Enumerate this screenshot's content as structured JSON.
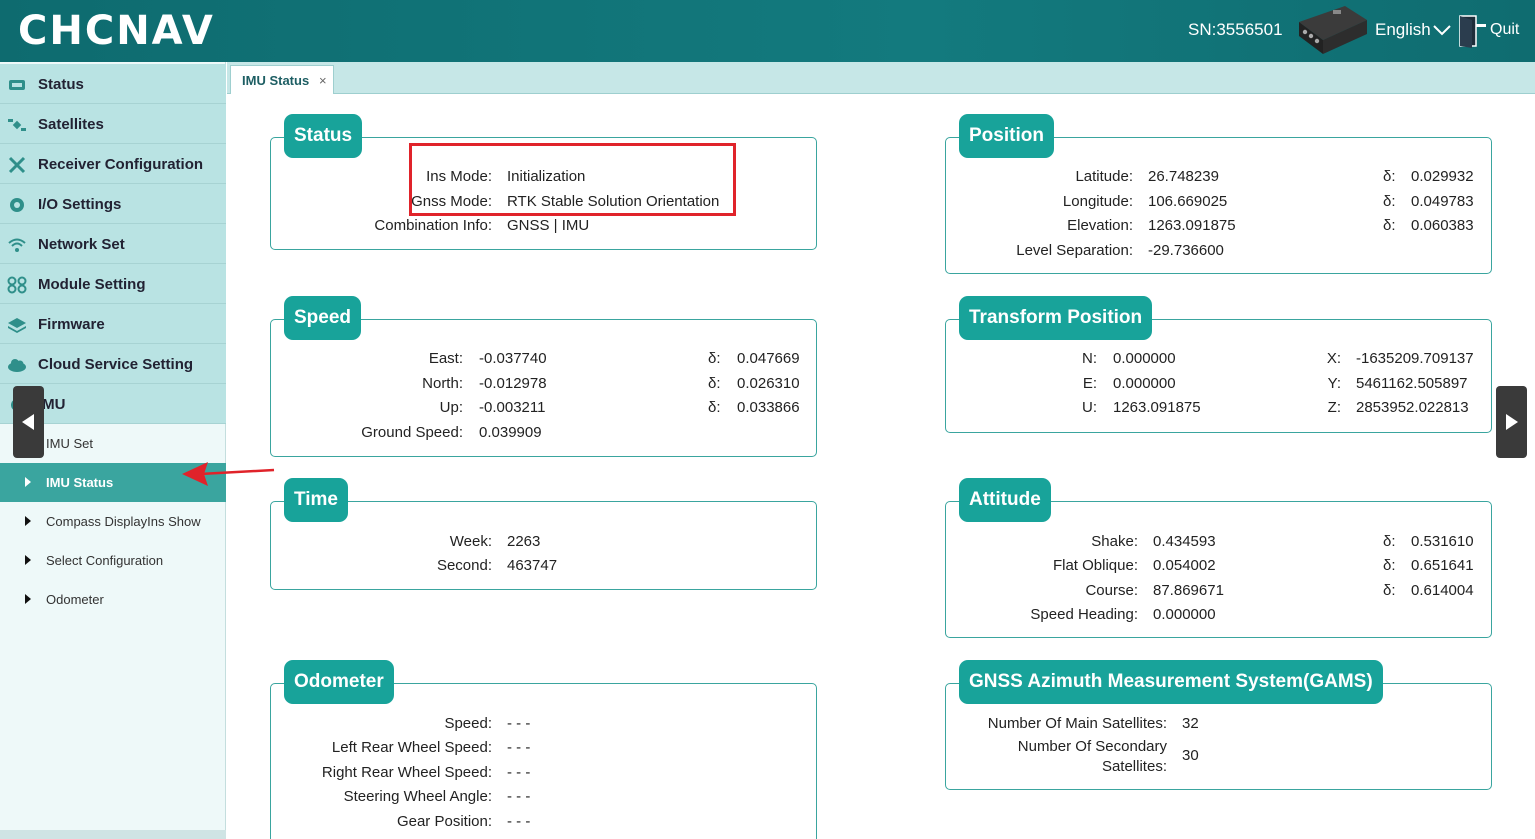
{
  "header": {
    "logo": "CHCNAV",
    "sn": "SN:3556501",
    "language": "English",
    "quit": "Quit"
  },
  "sidebar": {
    "items": [
      {
        "label": "Status",
        "icon": "monitor-icon"
      },
      {
        "label": "Satellites",
        "icon": "satellite-icon"
      },
      {
        "label": "Receiver Configuration",
        "icon": "tools-icon"
      },
      {
        "label": "I/O Settings",
        "icon": "gear-icon"
      },
      {
        "label": "Network Set",
        "icon": "wifi-icon"
      },
      {
        "label": "Module Setting",
        "icon": "modules-icon"
      },
      {
        "label": "Firmware",
        "icon": "layers-icon"
      },
      {
        "label": "Cloud Service Setting",
        "icon": "cloud-icon"
      },
      {
        "label": "IMU",
        "icon": "imu-icon"
      }
    ],
    "sub_items": [
      {
        "label": "IMU Set"
      },
      {
        "label": "IMU Status"
      },
      {
        "label": "Compass DisplayIns Show"
      },
      {
        "label": "Select Configuration"
      },
      {
        "label": "Odometer"
      }
    ]
  },
  "tab": {
    "label": "IMU Status",
    "close": "×"
  },
  "status": {
    "title": "Status",
    "ins_mode_label": "Ins Mode:",
    "ins_mode": "Initialization",
    "gnss_mode_label": "Gnss Mode:",
    "gnss_mode": "RTK Stable Solution Orientation",
    "combination_label": "Combination Info:",
    "combination": "GNSS | IMU"
  },
  "position": {
    "title": "Position",
    "latitude_label": "Latitude:",
    "latitude": "26.748239",
    "latitude_delta": "0.029932",
    "longitude_label": "Longitude:",
    "longitude": "106.669025",
    "longitude_delta": "0.049783",
    "elevation_label": "Elevation:",
    "elevation": "1263.091875",
    "elevation_delta": "0.060383",
    "level_label": "Level Separation:",
    "level": "-29.736600",
    "delta_label": "δ:"
  },
  "speed": {
    "title": "Speed",
    "east_label": "East:",
    "east": "-0.037740",
    "east_delta": "0.047669",
    "north_label": "North:",
    "north": "-0.012978",
    "north_delta": "0.026310",
    "up_label": "Up:",
    "up": "-0.003211",
    "up_delta": "0.033866",
    "ground_label": "Ground Speed:",
    "ground": "0.039909",
    "delta_label": "δ:"
  },
  "transform": {
    "title": "Transform Position",
    "n_label": "N:",
    "n": "0.000000",
    "e_label": "E:",
    "e": "0.000000",
    "u_label": "U:",
    "u": "1263.091875",
    "x_label": "X:",
    "x": "-1635209.709137",
    "y_label": "Y:",
    "y": "5461162.505897",
    "z_label": "Z:",
    "z": "2853952.022813"
  },
  "time": {
    "title": "Time",
    "week_label": "Week:",
    "week": "2263",
    "second_label": "Second:",
    "second": "463747"
  },
  "attitude": {
    "title": "Attitude",
    "shake_label": "Shake:",
    "shake": "0.434593",
    "shake_delta": "0.531610",
    "flat_label": "Flat Oblique:",
    "flat": "0.054002",
    "flat_delta": "0.651641",
    "course_label": "Course:",
    "course": "87.869671",
    "course_delta": "0.614004",
    "heading_label": "Speed Heading:",
    "heading": "0.000000",
    "delta_label": "δ:"
  },
  "odometer": {
    "title": "Odometer",
    "speed_label": "Speed:",
    "speed": "- - -",
    "left_label": "Left Rear Wheel Speed:",
    "left": "- - -",
    "right_label": "Right Rear Wheel Speed:",
    "right": "- - -",
    "steering_label": "Steering Wheel Angle:",
    "steering": "- - -",
    "gear_label": "Gear Position:",
    "gear": "- - -"
  },
  "gams": {
    "title": "GNSS Azimuth Measurement System(GAMS)",
    "main_label": "Number Of Main Satellites:",
    "main": "32",
    "secondary_label": "Number Of Secondary Satellites:",
    "secondary": "30"
  },
  "colors": {
    "header": "#137a7e",
    "accent": "#18a39a",
    "sidebar_item": "#b9e3e3",
    "active": "#3aa59f",
    "highlight": "#e0232a"
  }
}
